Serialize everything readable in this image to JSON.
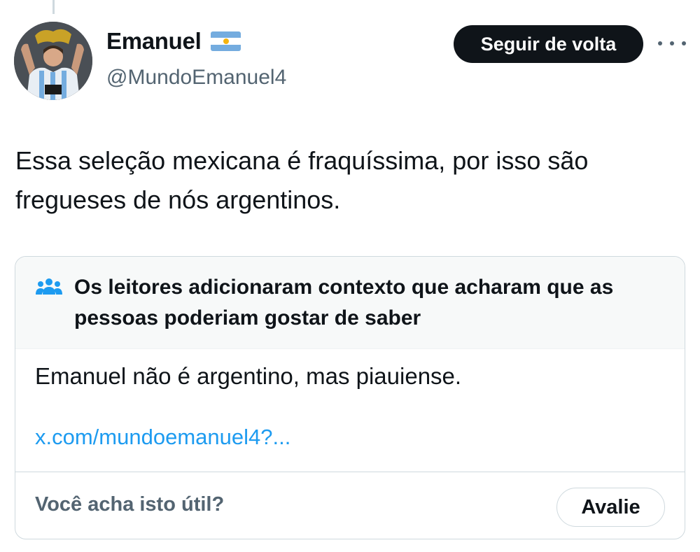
{
  "author": {
    "display_name": "Emanuel",
    "handle": "@MundoEmanuel4",
    "flag_icon": "argentina-flag-icon",
    "avatar_icon": "profile-photo"
  },
  "follow_button": {
    "label": "Seguir de volta"
  },
  "more_button": {
    "icon": "more-horizontal-icon"
  },
  "tweet": {
    "text": "Essa seleção mexicana é fraquíssima, por isso são fregueses de nós argentinos."
  },
  "community_note": {
    "icon": "people-icon",
    "title": "Os leitores adicionaram contexto que acharam que as pessoas poderiam gostar de saber",
    "body": "Emanuel não é argentino, mas piauiense.",
    "link": "x.com/mundoemanuel4?...",
    "footer_question": "Você acha isto útil?",
    "rate_label": "Avalie"
  },
  "colors": {
    "text_primary": "#0f1419",
    "text_secondary": "#536471",
    "link": "#1d9bf0",
    "border": "#cfd9de",
    "note_header_bg": "#f7f9f9",
    "note_icon": "#1d9bf0",
    "flag_blue": "#74acdf",
    "flag_white": "#ffffff",
    "flag_sun": "#f6b40e"
  }
}
